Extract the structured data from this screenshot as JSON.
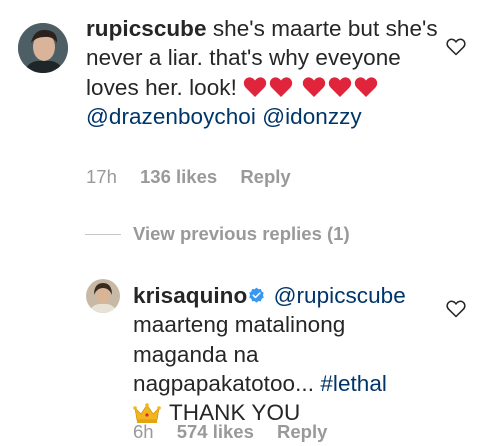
{
  "comments": [
    {
      "username": "rupicscube",
      "text_1": "she's maarte but she's never a liar. that's why eveyone loves her. look!",
      "mention_1": "@drazenboychoi",
      "mention_2": "@idonzzy",
      "hearts_count": 5,
      "time": "17h",
      "likes": "136 likes",
      "reply_label": "Reply"
    }
  ],
  "view_replies_label": "View previous replies (1)",
  "reply": {
    "username": "krisaquino",
    "verified": true,
    "mention": "@rupicscube",
    "text": "maarteng matalinong maganda na nagpapakatotoo...",
    "hashtag": "#lethal",
    "crown_text": "THANK YOU",
    "time": "6h",
    "likes": "574 likes",
    "reply_label": "Reply"
  },
  "colors": {
    "text": "#262626",
    "link": "#003569",
    "meta": "#999999",
    "heart_emoji": "#e0243b",
    "verified": "#3897f0"
  },
  "icons": [
    "heart-outline-icon",
    "heart-emoji-icon",
    "verified-badge-icon",
    "crown-emoji-icon"
  ]
}
